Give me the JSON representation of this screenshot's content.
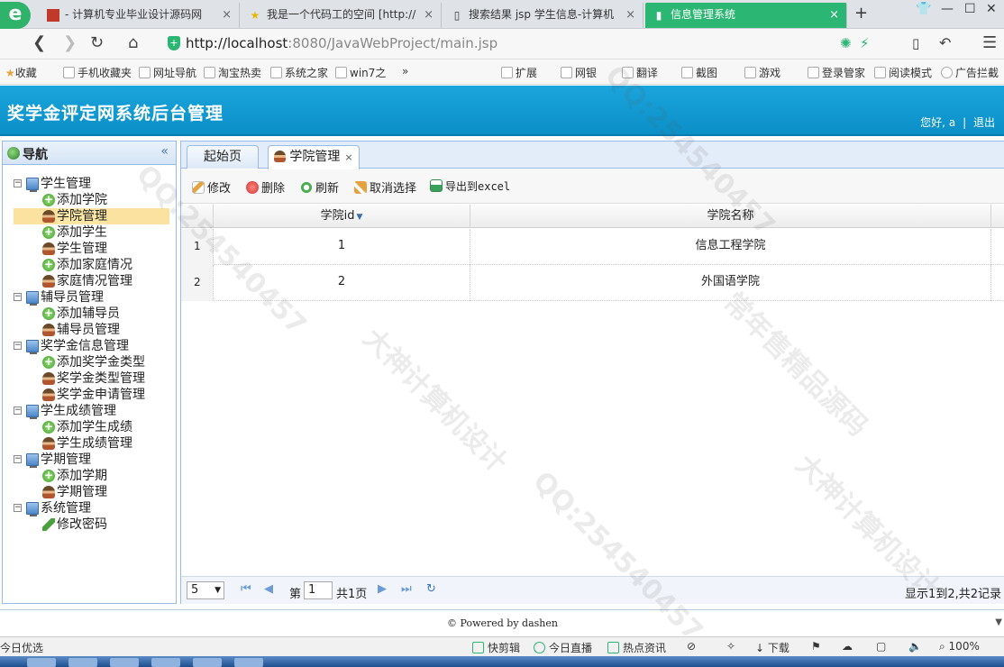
{
  "browser": {
    "tabs": [
      {
        "label": "- 计算机专业毕业设计源码网"
      },
      {
        "label": "我是一个代码工的空间 [http://"
      },
      {
        "label": "搜索结果 jsp 学生信息-计算机"
      },
      {
        "label": "信息管理系统"
      }
    ],
    "url_host": "http://localhost",
    "url_path": ":8080/JavaWebProject/main.jsp",
    "bookmarks": [
      "收藏",
      "手机收藏夹",
      "网址导航",
      "淘宝热卖",
      "系统之家",
      "win7之",
      "扩展",
      "网银",
      "翻译",
      "截图",
      "游戏",
      "登录管家",
      "阅读模式",
      "广告拦截"
    ]
  },
  "app": {
    "title": "奖学金评定网系统后台管理",
    "greeting": "您好,",
    "user": "a",
    "logout": "退出"
  },
  "nav": {
    "title": "导航",
    "groups": [
      {
        "label": "学生管理",
        "items": [
          "添加学院",
          "学院管理",
          "添加学生",
          "学生管理",
          "添加家庭情况",
          "家庭情况管理"
        ]
      },
      {
        "label": "辅导员管理",
        "items": [
          "添加辅导员",
          "辅导员管理"
        ]
      },
      {
        "label": "奖学金信息管理",
        "items": [
          "添加奖学金类型",
          "奖学金类型管理",
          "奖学金申请管理"
        ]
      },
      {
        "label": "学生成绩管理",
        "items": [
          "添加学生成绩",
          "学生成绩管理"
        ]
      },
      {
        "label": "学期管理",
        "items": [
          "添加学期",
          "学期管理"
        ]
      },
      {
        "label": "系统管理",
        "items": [
          "修改密码"
        ]
      }
    ],
    "selected": "学院管理"
  },
  "content": {
    "tabs": [
      {
        "label": "起始页"
      },
      {
        "label": "学院管理"
      }
    ],
    "toolbar": {
      "edit": "修改",
      "delete": "删除",
      "refresh": "刷新",
      "cancel_select": "取消选择",
      "export": "导出到excel"
    },
    "columns": [
      "学院id",
      "学院名称"
    ],
    "rows": [
      {
        "n": "1",
        "id": "1",
        "name": "信息工程学院"
      },
      {
        "n": "2",
        "id": "2",
        "name": "外国语学院"
      }
    ],
    "pager": {
      "page_size": "5",
      "page_prefix": "第",
      "page": "1",
      "page_total": "共1页",
      "summary": "显示1到2,共2记录"
    }
  },
  "footer": "© Powered by dashen",
  "statusbar": {
    "left": "今日优选",
    "items": [
      "快剪辑",
      "今日直播",
      "热点资讯",
      "下载"
    ],
    "zoom": "100%"
  },
  "watermarks": [
    "QQ:254540457",
    "大神计算机设计",
    "常年售精品源码"
  ],
  "colors": {
    "header": "#0b8fc7",
    "active_tab": "#2cb674",
    "selection": "#fbe2a0"
  }
}
